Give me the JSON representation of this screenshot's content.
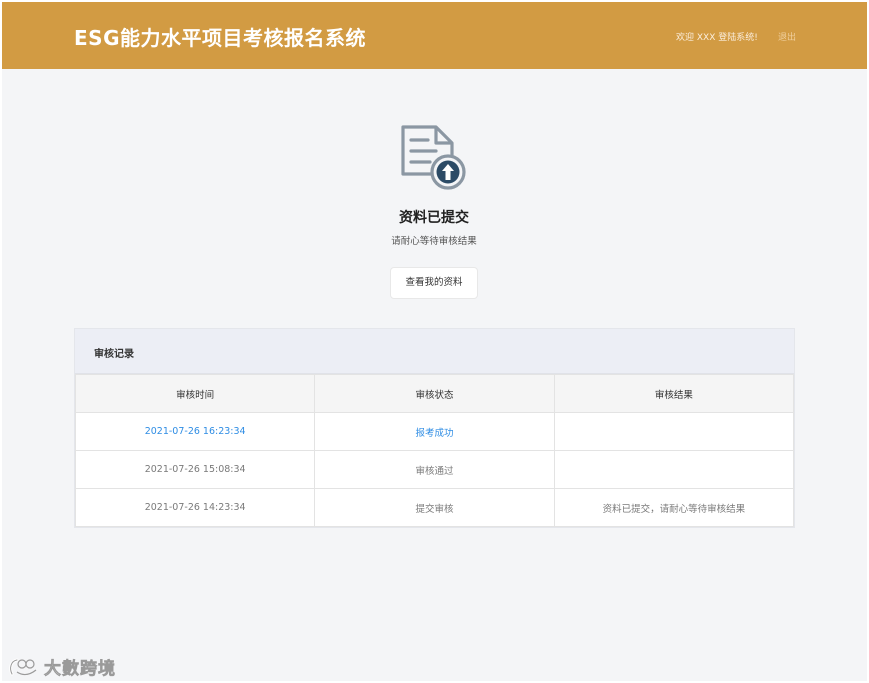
{
  "header": {
    "app_title": "ESG能力水平项目考核报名系统",
    "welcome_text": "欢迎 XXX 登陆系统!",
    "logout_label": "退出",
    "brand_color": "#d29b43"
  },
  "status": {
    "icon": "document-upload-icon",
    "title": "资料已提交",
    "subtitle": "请耐心等待审核结果",
    "view_button_label": "查看我的资料"
  },
  "records": {
    "title": "审核记录",
    "columns": [
      "审核时间",
      "审核状态",
      "审核结果"
    ],
    "rows": [
      {
        "time": "2021-07-26 16:23:34",
        "status": "报考成功",
        "result": ""
      },
      {
        "time": "2021-07-26 15:08:34",
        "status": "审核通过",
        "result": ""
      },
      {
        "time": "2021-07-26 14:23:34",
        "status": "提交审核",
        "result": "资料已提交，请耐心等待审核结果"
      }
    ],
    "highlight_color": "#2f8de4"
  },
  "watermark": {
    "icon": "brand-logo-icon",
    "text": "大數跨境"
  }
}
